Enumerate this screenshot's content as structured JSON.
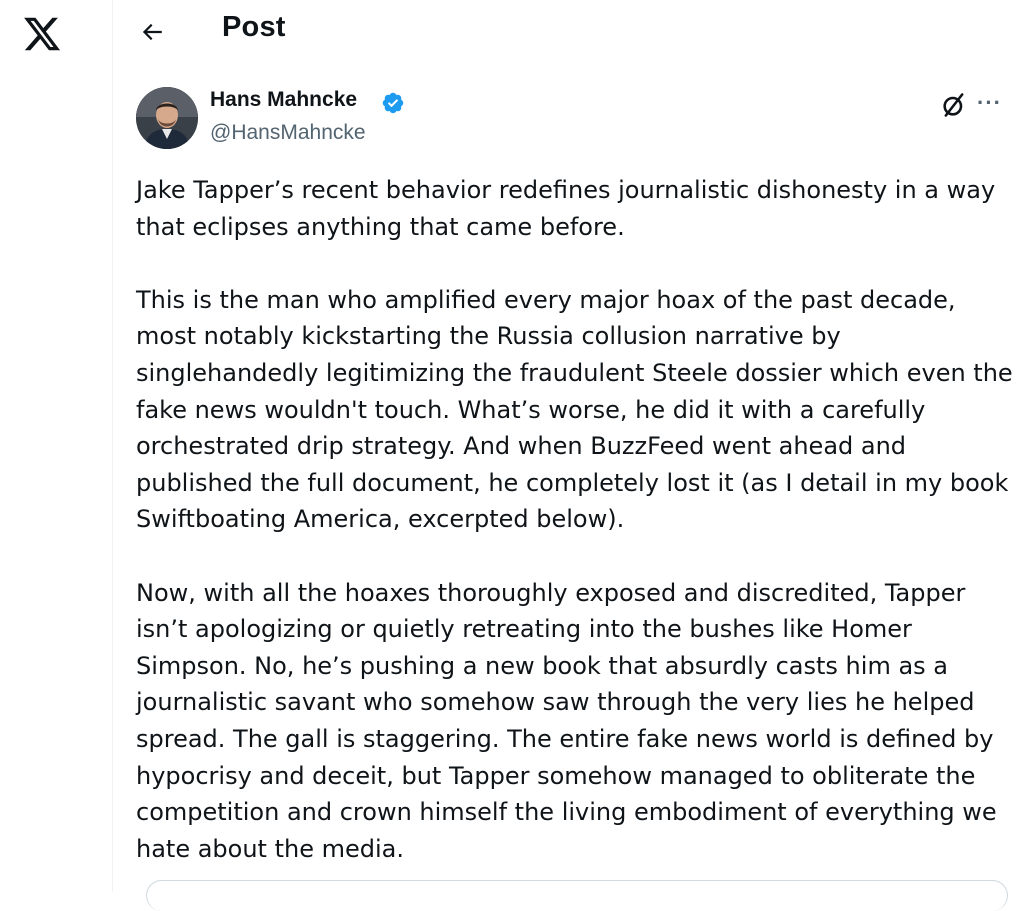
{
  "nav": {
    "logo_icon": "x-logo-icon",
    "back_icon": "arrow-left-icon",
    "title": "Post"
  },
  "post": {
    "author": {
      "name": "Hans Mahncke",
      "handle": "@HansMahncke",
      "verified": true,
      "verified_color": "#1d9bf0"
    },
    "actions": {
      "grok_icon": "grok-icon",
      "more_label": "···"
    },
    "paragraphs": [
      "Jake Tapper’s recent behavior redefines journalistic dishonesty in a way\nthat eclipses anything that came before.",
      "This is the man who amplified every major hoax of the past decade,\nmost notably kickstarting the Russia collusion narrative by\nsinglehandedly legitimizing the fraudulent Steele dossier which even the\nfake news wouldn't touch. What’s worse, he did it with a carefully\norchestrated drip strategy. And when BuzzFeed went ahead and\npublished the full document, he completely lost it (as I detail in my book\nSwiftboating America, excerpted below).",
      "Now, with all the hoaxes thoroughly exposed and discredited, Tapper\nisn’t apologizing or quietly retreating into the bushes like Homer\nSimpson. No, he’s pushing a new book that absurdly casts him as a\njournalistic savant who somehow saw through the very lies he helped\nspread. The gall is staggering. The entire fake news world is defined by\nhypocrisy and deceit, but Tapper somehow managed to obliterate the\ncompetition and crown himself the living embodiment of everything we\nhate about the media."
    ]
  },
  "colors": {
    "text": "#0f1419",
    "secondary": "#536471",
    "border": "#eff3f4"
  }
}
